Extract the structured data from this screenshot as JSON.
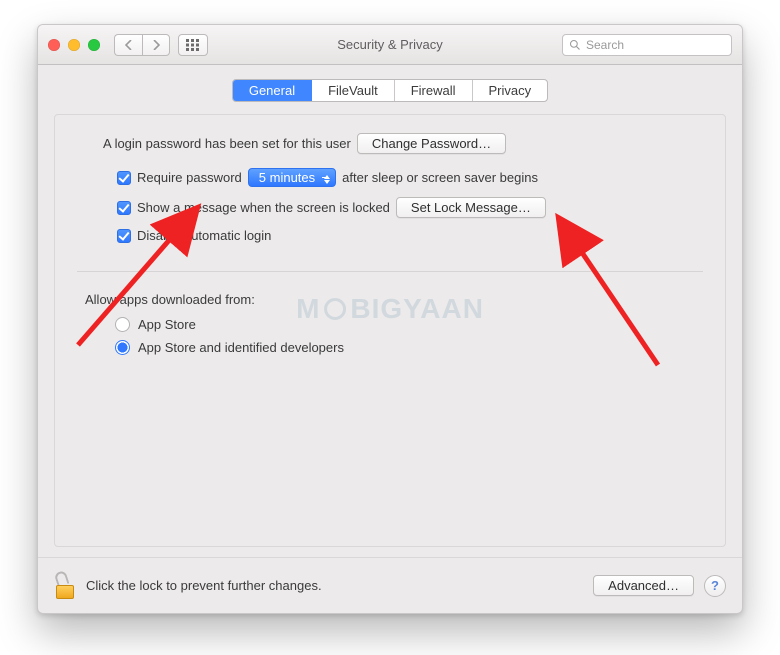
{
  "window": {
    "title": "Security & Privacy"
  },
  "search": {
    "placeholder": "Search"
  },
  "tabs": {
    "general": "General",
    "filevault": "FileVault",
    "firewall": "Firewall",
    "privacy": "Privacy"
  },
  "login": {
    "password_set_text": "A login password has been set for this user",
    "change_btn": "Change Password…",
    "require_pw_label_pre": "Require password",
    "require_pw_delay": "5 minutes",
    "require_pw_label_post": "after sleep or screen saver begins",
    "show_lock_msg_label": "Show a message when the screen is locked",
    "set_lock_msg_btn": "Set Lock Message…",
    "disable_auto_login_label": "Disable automatic login"
  },
  "allow": {
    "header": "Allow apps downloaded from:",
    "opt_appstore": "App Store",
    "opt_identified": "App Store and identified developers"
  },
  "footer": {
    "lock_text": "Click the lock to prevent further changes.",
    "advanced_btn": "Advanced…",
    "help": "?"
  },
  "watermark": {
    "pre": "M",
    "post": "BIGYAAN"
  }
}
